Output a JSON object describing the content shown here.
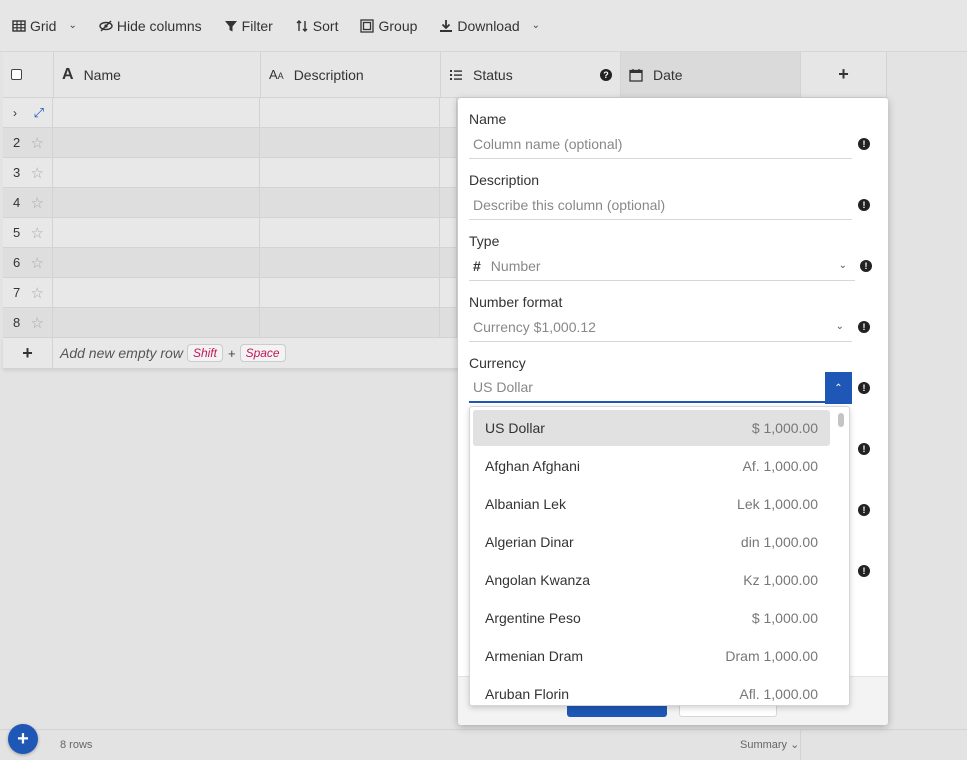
{
  "toolbar": {
    "grid": "Grid",
    "hide_columns": "Hide columns",
    "filter": "Filter",
    "sort": "Sort",
    "group": "Group",
    "download": "Download"
  },
  "columns": {
    "name": "Name",
    "description": "Description",
    "status": "Status",
    "date": "Date",
    "add": "+"
  },
  "rows": [
    "2",
    "3",
    "4",
    "5",
    "6",
    "7",
    "8"
  ],
  "add_row": {
    "plus": "+",
    "label": "Add new empty row",
    "key1": "Shift",
    "plus_sep": "+",
    "key2": "Space"
  },
  "footer": {
    "row_count": "8 rows",
    "summary": "Summary"
  },
  "panel": {
    "name_label": "Name",
    "name_placeholder": "Column name (optional)",
    "description_label": "Description",
    "description_placeholder": "Describe this column (optional)",
    "type_label": "Type",
    "type_symbol": "#",
    "type_value": "Number",
    "number_format_label": "Number format",
    "number_format_value": "Currency $1,000.12",
    "currency_label": "Currency",
    "currency_placeholder": "US Dollar"
  },
  "currencies": [
    {
      "name": "US Dollar",
      "format": "$ 1,000.00"
    },
    {
      "name": "Afghan Afghani",
      "format": "Af. 1,000.00"
    },
    {
      "name": "Albanian Lek",
      "format": "Lek 1,000.00"
    },
    {
      "name": "Algerian Dinar",
      "format": "din 1,000.00"
    },
    {
      "name": "Angolan Kwanza",
      "format": "Kz 1,000.00"
    },
    {
      "name": "Argentine Peso",
      "format": "$ 1,000.00"
    },
    {
      "name": "Armenian Dram",
      "format": "Dram 1,000.00"
    },
    {
      "name": "Aruban Florin",
      "format": "Afl. 1,000.00"
    }
  ],
  "colors": {
    "accent": "#1e57b5",
    "kbd_text": "#c2185b"
  }
}
